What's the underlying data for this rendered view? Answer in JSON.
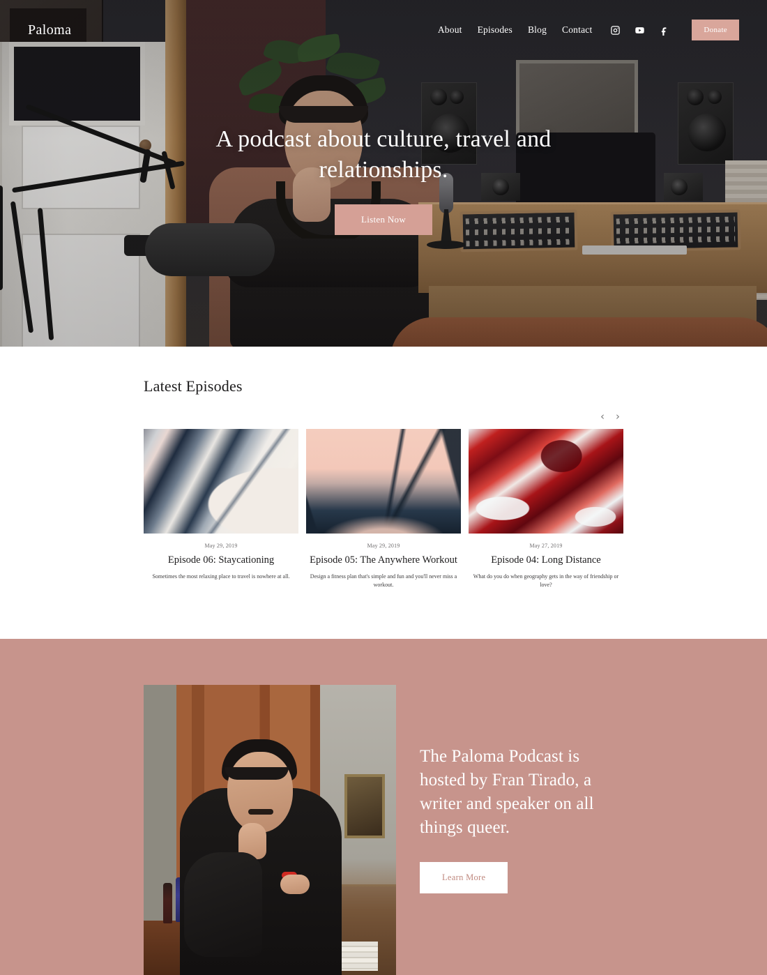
{
  "site": {
    "logo": "Paloma",
    "accent_pink": "#c7948c",
    "button_pink": "#d5a096",
    "donate_pink": "#d9a69b"
  },
  "nav": {
    "links": [
      {
        "label": "About"
      },
      {
        "label": "Episodes"
      },
      {
        "label": "Blog"
      },
      {
        "label": "Contact"
      }
    ],
    "social": [
      {
        "name": "instagram-icon"
      },
      {
        "name": "youtube-icon"
      },
      {
        "name": "facebook-icon"
      }
    ],
    "donate_label": "Donate"
  },
  "hero": {
    "title": "A podcast about culture, travel and relationships.",
    "cta_label": "Listen Now"
  },
  "episodes": {
    "heading": "Latest Episodes",
    "prev_arrow": "‹",
    "next_arrow": "›",
    "items": [
      {
        "date": "May 29, 2019",
        "title": "Episode 06: Staycationing",
        "description": "Sometimes the most relaxing place to travel is nowhere at all."
      },
      {
        "date": "May 29, 2019",
        "title": "Episode 05: The Anywhere Workout",
        "description": "Design a fitness plan that's simple and fun and you'll never miss a workout."
      },
      {
        "date": "May 27, 2019",
        "title": "Episode 04: Long Distance",
        "description": "What do you do when geography gets in the way of friendship or love?"
      }
    ]
  },
  "about": {
    "heading": "The Paloma Podcast is hosted by Fran Tirado, a writer and speaker on all things queer.",
    "cta_label": "Learn More"
  }
}
